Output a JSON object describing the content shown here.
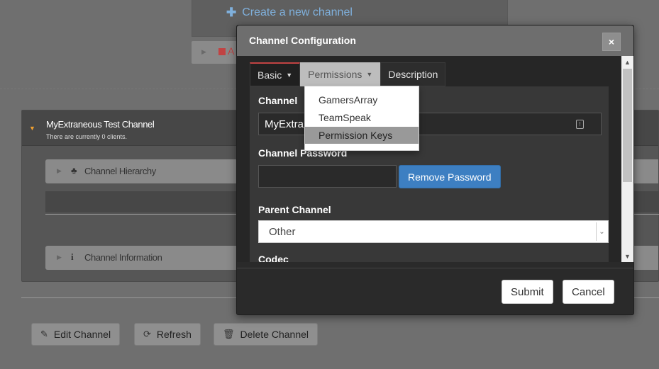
{
  "background": {
    "create_channel": {
      "icon": "plus-icon",
      "label": "Create a new channel"
    },
    "partial_tab_letter": "A",
    "channel": {
      "name": "MyExtraneous Test Channel",
      "status": "There are currently 0 clients."
    },
    "sections": [
      {
        "icon": "sitemap-icon",
        "label": "Channel Hierarchy"
      },
      {
        "icon": "info-icon",
        "label": "Channel Information"
      }
    ],
    "actions": {
      "edit": "Edit Channel",
      "refresh": "Refresh",
      "delete": "Delete Channel"
    }
  },
  "modal": {
    "title": "Channel Configuration",
    "close": "×",
    "tabs": {
      "basic": "Basic",
      "permissions": "Permissions",
      "description": "Description"
    },
    "permissions_menu": [
      "GamersArray",
      "TeamSpeak",
      "Permission Keys"
    ],
    "form": {
      "channel_name_label": "Channel",
      "channel_name_value": "MyExtra",
      "password_label": "Channel Password",
      "password_value": "",
      "remove_password": "Remove Password",
      "parent_label": "Parent Channel",
      "parent_value": "Other",
      "codec_label": "Codec"
    },
    "footer": {
      "submit": "Submit",
      "cancel": "Cancel"
    }
  },
  "colors": {
    "accent_red": "#c14343",
    "primary_blue": "#3d7fc2",
    "link_blue": "#7fb0dc"
  }
}
